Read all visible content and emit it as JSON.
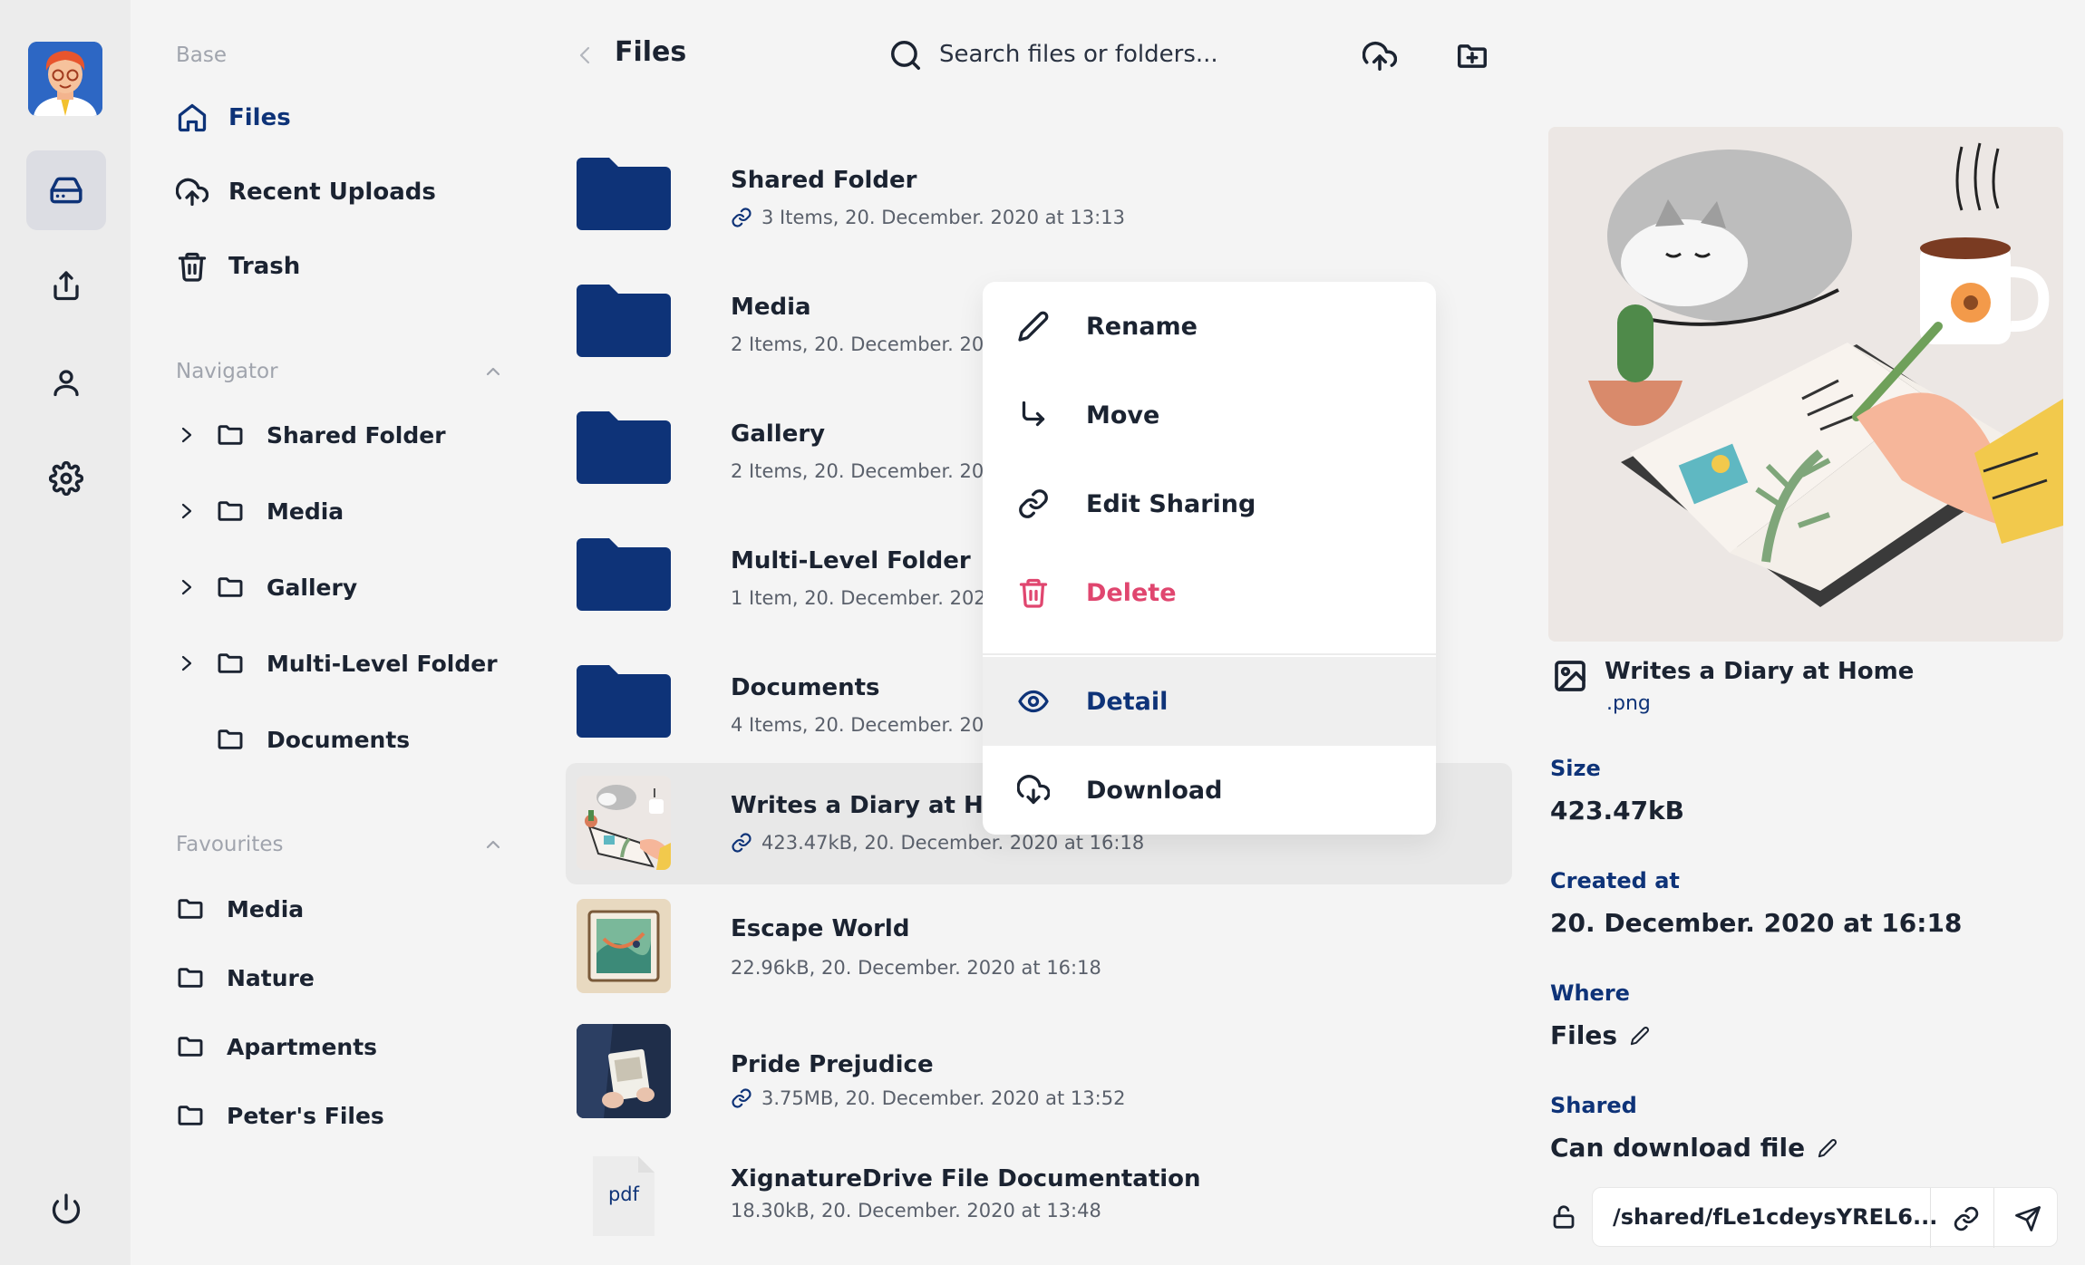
{
  "sidebar": {
    "base_title": "Base",
    "items": [
      {
        "label": "Files",
        "icon": "home-icon"
      },
      {
        "label": "Recent Uploads",
        "icon": "cloud-upload-icon"
      },
      {
        "label": "Trash",
        "icon": "trash-icon"
      }
    ],
    "navigator_title": "Navigator",
    "navigator": [
      {
        "label": "Shared Folder",
        "expandable": true
      },
      {
        "label": "Media",
        "expandable": true
      },
      {
        "label": "Gallery",
        "expandable": true
      },
      {
        "label": "Multi-Level Folder",
        "expandable": true
      },
      {
        "label": "Documents",
        "expandable": false
      }
    ],
    "favourites_title": "Favourites",
    "favourites": [
      {
        "label": "Media"
      },
      {
        "label": "Nature"
      },
      {
        "label": "Apartments"
      },
      {
        "label": "Peter's Files"
      }
    ]
  },
  "header": {
    "title": "Files",
    "search_placeholder": "Search files or folders..."
  },
  "files": [
    {
      "name": "Shared Folder",
      "meta": "3 Items, 20. December. 2020 at 13:13",
      "type": "folder",
      "shared": true
    },
    {
      "name": "Media",
      "meta": "2 Items, 20. December. 2020 at 13:13",
      "type": "folder",
      "shared": false
    },
    {
      "name": "Gallery",
      "meta": "2 Items, 20. December. 2020 at 13:13",
      "type": "folder",
      "shared": false
    },
    {
      "name": "Multi-Level Folder",
      "meta": "1 Item, 20. December. 2020 at 13:13",
      "type": "folder",
      "shared": false
    },
    {
      "name": "Documents",
      "meta": "4 Items, 20. December. 2020 at 13:13",
      "type": "folder",
      "shared": false
    },
    {
      "name": "Writes a Diary at Home",
      "meta": "423.47kB, 20. December. 2020 at 16:18",
      "type": "image",
      "shared": true,
      "selected": true
    },
    {
      "name": "Escape World",
      "meta": "22.96kB, 20. December. 2020 at 16:18",
      "type": "image",
      "shared": false
    },
    {
      "name": "Pride Prejudice",
      "meta": "3.75MB, 20. December. 2020 at 13:52",
      "type": "image",
      "shared": true
    },
    {
      "name": "XignatureDrive File Documentation",
      "meta": "18.30kB, 20. December. 2020 at 13:48",
      "type": "pdf",
      "shared": false,
      "badge": "pdf"
    }
  ],
  "context_menu": {
    "rename": "Rename",
    "move": "Move",
    "edit_sharing": "Edit Sharing",
    "delete": "Delete",
    "detail": "Detail",
    "download": "Download"
  },
  "detail": {
    "title": "Writes a Diary at Home",
    "ext": ".png",
    "size_label": "Size",
    "size": "423.47kB",
    "created_label": "Created at",
    "created": "20. December. 2020 at 16:18",
    "where_label": "Where",
    "where": "Files",
    "shared_label": "Shared",
    "shared": "Can download file",
    "share_url": "/shared/fLe1cdeysYREL6..."
  },
  "colors": {
    "accent": "#0e3378",
    "folder": "#0e3378",
    "danger": "#e0466f"
  }
}
